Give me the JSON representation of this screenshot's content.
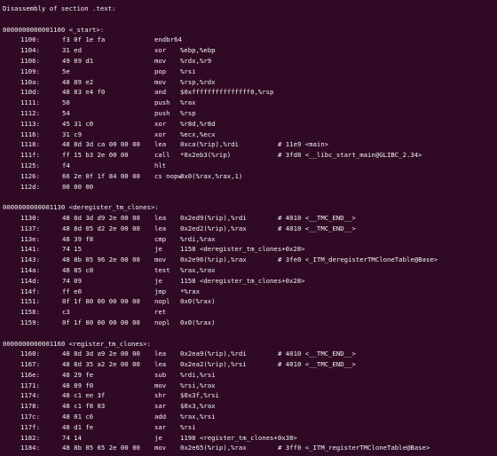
{
  "header": "Disassembly of section .text:",
  "sections": [
    {
      "label": "0000000000001100 <_start>:",
      "rows": [
        {
          "addr": "1100:",
          "bytes": "f3 0f 1e fa",
          "mnem": "endbr64",
          "ops": "",
          "comment": ""
        },
        {
          "addr": "1104:",
          "bytes": "31 ed",
          "mnem": "xor",
          "ops": "%ebp,%ebp",
          "comment": ""
        },
        {
          "addr": "1106:",
          "bytes": "49 89 d1",
          "mnem": "mov",
          "ops": "%rdx,%r9",
          "comment": ""
        },
        {
          "addr": "1109:",
          "bytes": "5e",
          "mnem": "pop",
          "ops": "%rsi",
          "comment": ""
        },
        {
          "addr": "110a:",
          "bytes": "48 89 e2",
          "mnem": "mov",
          "ops": "%rsp,%rdx",
          "comment": ""
        },
        {
          "addr": "110d:",
          "bytes": "48 83 e4 f0",
          "mnem": "and",
          "ops": "$0xfffffffffffffff0,%rsp",
          "comment": ""
        },
        {
          "addr": "1111:",
          "bytes": "50",
          "mnem": "push",
          "ops": "%rax",
          "comment": ""
        },
        {
          "addr": "1112:",
          "bytes": "54",
          "mnem": "push",
          "ops": "%rsp",
          "comment": ""
        },
        {
          "addr": "1113:",
          "bytes": "45 31 c0",
          "mnem": "xor",
          "ops": "%r8d,%r8d",
          "comment": ""
        },
        {
          "addr": "1116:",
          "bytes": "31 c9",
          "mnem": "xor",
          "ops": "%ecx,%ecx",
          "comment": ""
        },
        {
          "addr": "1118:",
          "bytes": "48 8d 3d ca 00 00 00",
          "mnem": "lea",
          "ops": "0xca(%rip),%rdi",
          "comment": "# 11e9 <main>"
        },
        {
          "addr": "111f:",
          "bytes": "ff 15 b3 2e 00 00",
          "mnem": "call",
          "ops": "*0x2eb3(%rip)",
          "comment": "# 3fd8 <__libc_start_main@GLIBC_2.34>"
        },
        {
          "addr": "1125:",
          "bytes": "f4",
          "mnem": "hlt",
          "ops": "",
          "comment": ""
        },
        {
          "addr": "1126:",
          "bytes": "66 2e 0f 1f 84 00 00",
          "mnem": "cs nopw",
          "ops": "0x0(%rax,%rax,1)",
          "comment": ""
        },
        {
          "addr": "112d:",
          "bytes": "00 00 00",
          "mnem": "",
          "ops": "",
          "comment": ""
        }
      ]
    },
    {
      "label": "0000000000001130 <deregister_tm_clones>:",
      "rows": [
        {
          "addr": "1130:",
          "bytes": "48 8d 3d d9 2e 00 00",
          "mnem": "lea",
          "ops": "0x2ed9(%rip),%rdi",
          "comment": "# 4010 <__TMC_END__>"
        },
        {
          "addr": "1137:",
          "bytes": "48 8d 05 d2 2e 00 00",
          "mnem": "lea",
          "ops": "0x2ed2(%rip),%rax",
          "comment": "# 4010 <__TMC_END__>"
        },
        {
          "addr": "113e:",
          "bytes": "48 39 f8",
          "mnem": "cmp",
          "ops": "%rdi,%rax",
          "comment": ""
        },
        {
          "addr": "1141:",
          "bytes": "74 15",
          "mnem": "je",
          "ops": "1158 <deregister_tm_clones+0x28>",
          "comment": ""
        },
        {
          "addr": "1143:",
          "bytes": "48 8b 05 96 2e 00 00",
          "mnem": "mov",
          "ops": "0x2e96(%rip),%rax",
          "comment": "# 3fe0 <_ITM_deregisterTMCloneTable@Base>"
        },
        {
          "addr": "114a:",
          "bytes": "48 85 c0",
          "mnem": "test",
          "ops": "%rax,%rax",
          "comment": ""
        },
        {
          "addr": "114d:",
          "bytes": "74 09",
          "mnem": "je",
          "ops": "1158 <deregister_tm_clones+0x28>",
          "comment": ""
        },
        {
          "addr": "114f:",
          "bytes": "ff e0",
          "mnem": "jmp",
          "ops": "*%rax",
          "comment": ""
        },
        {
          "addr": "1151:",
          "bytes": "0f 1f 80 00 00 00 00",
          "mnem": "nopl",
          "ops": "0x0(%rax)",
          "comment": ""
        },
        {
          "addr": "1158:",
          "bytes": "c3",
          "mnem": "ret",
          "ops": "",
          "comment": ""
        },
        {
          "addr": "1159:",
          "bytes": "0f 1f 80 00 00 00 00",
          "mnem": "nopl",
          "ops": "0x0(%rax)",
          "comment": ""
        }
      ]
    },
    {
      "label": "0000000000001160 <register_tm_clones>:",
      "rows": [
        {
          "addr": "1160:",
          "bytes": "48 8d 3d a9 2e 00 00",
          "mnem": "lea",
          "ops": "0x2ea9(%rip),%rdi",
          "comment": "# 4010 <__TMC_END__>"
        },
        {
          "addr": "1167:",
          "bytes": "48 8d 35 a2 2e 00 00",
          "mnem": "lea",
          "ops": "0x2ea2(%rip),%rsi",
          "comment": "# 4010 <__TMC_END__>"
        },
        {
          "addr": "116e:",
          "bytes": "48 29 fe",
          "mnem": "sub",
          "ops": "%rdi,%rsi",
          "comment": ""
        },
        {
          "addr": "1171:",
          "bytes": "48 89 f0",
          "mnem": "mov",
          "ops": "%rsi,%rax",
          "comment": ""
        },
        {
          "addr": "1174:",
          "bytes": "48 c1 ee 3f",
          "mnem": "shr",
          "ops": "$0x3f,%rsi",
          "comment": ""
        },
        {
          "addr": "1178:",
          "bytes": "48 c1 f8 03",
          "mnem": "sar",
          "ops": "$0x3,%rax",
          "comment": ""
        },
        {
          "addr": "117c:",
          "bytes": "48 01 c6",
          "mnem": "add",
          "ops": "%rax,%rsi",
          "comment": ""
        },
        {
          "addr": "117f:",
          "bytes": "48 d1 fe",
          "mnem": "sar",
          "ops": "%rsi",
          "comment": ""
        },
        {
          "addr": "1182:",
          "bytes": "74 14",
          "mnem": "je",
          "ops": "1198 <register_tm_clones+0x38>",
          "comment": ""
        },
        {
          "addr": "1184:",
          "bytes": "48 8b 05 65 2e 00 00",
          "mnem": "mov",
          "ops": "0x2e65(%rip),%rax",
          "comment": "# 3ff0 <_ITM_registerTMCloneTable@Base>"
        }
      ]
    }
  ]
}
